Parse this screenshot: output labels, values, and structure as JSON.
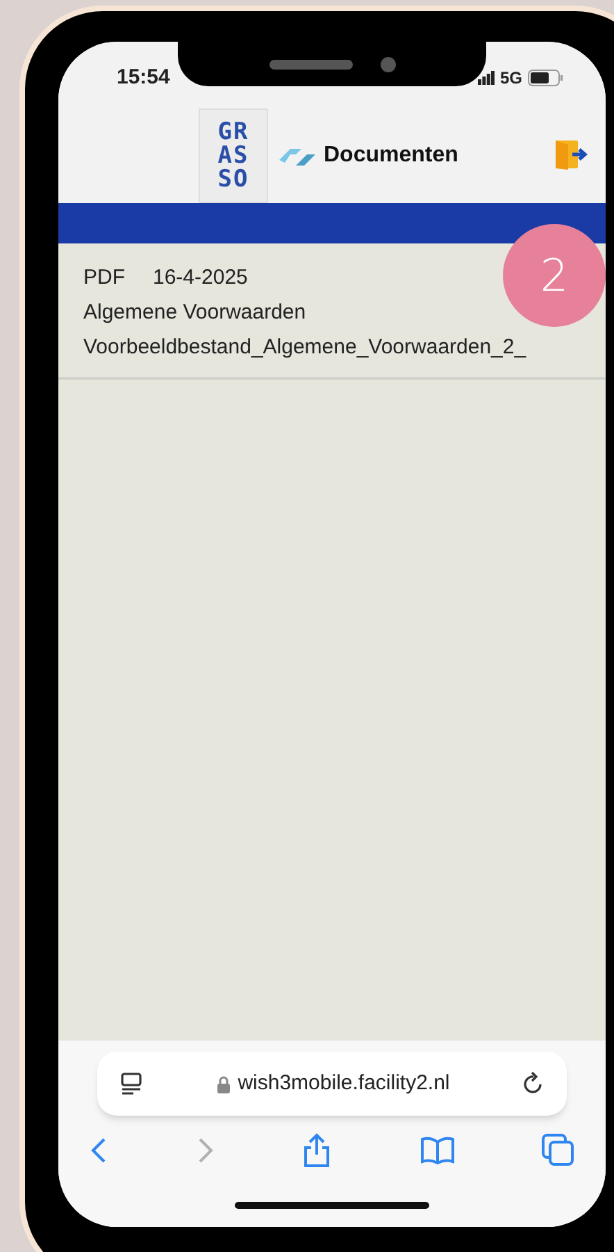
{
  "status_bar": {
    "time": "15:54",
    "network": "5G"
  },
  "header": {
    "logo_lines": [
      "GR",
      "AS",
      "SO"
    ],
    "title": "Documenten"
  },
  "documents": [
    {
      "type": "PDF",
      "date": "16-4-2025",
      "title": "Algemene Voorwaarden",
      "filename": "Voorbeeldbestand_Algemene_Voorwaarden_2_"
    }
  ],
  "step_badge": "2",
  "browser": {
    "url": "wish3mobile.facility2.nl",
    "back_enabled": true,
    "forward_enabled": false
  }
}
